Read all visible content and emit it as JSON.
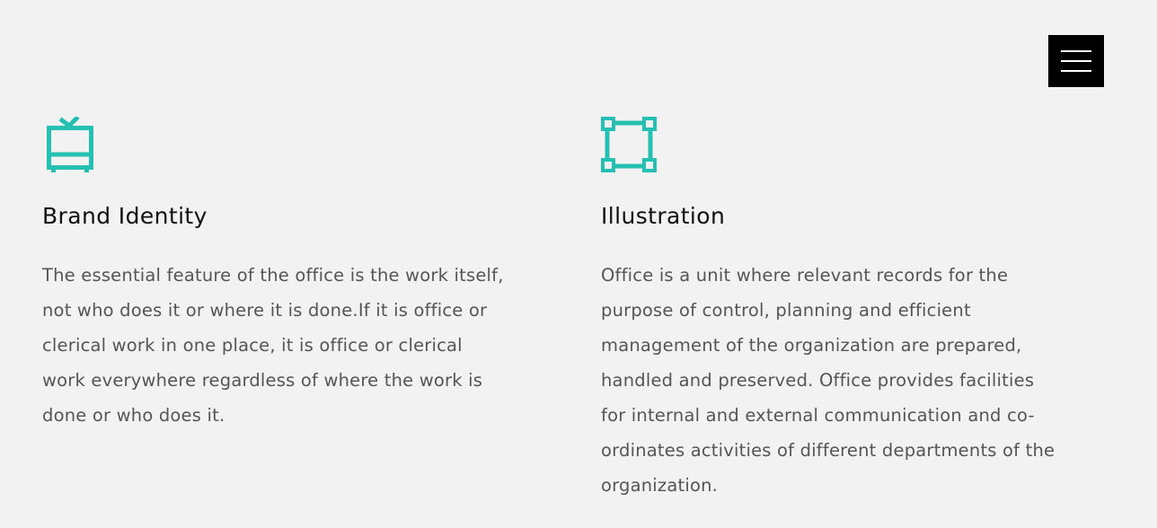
{
  "header": {
    "menu_icon": "hamburger-menu-icon"
  },
  "colors": {
    "accent": "#26c0b2",
    "background": "#f2f2f2",
    "menu_bg": "#000000",
    "text_heading": "#111111",
    "text_body": "#555555"
  },
  "services": [
    {
      "icon": "tv-icon",
      "title": "Brand Identity",
      "lines": [
        "The essential feature of the office is the work itself,",
        "not who does it or where it is done.If it is office or",
        "clerical work in one place, it is office or clerical",
        "work everywhere regardless of where the work is",
        "done or who does it."
      ]
    },
    {
      "icon": "vector-square-icon",
      "title": "Illustration",
      "lines": [
        "Office is a unit where relevant records for the",
        "purpose of control, planning and efficient",
        "management of the organization are prepared,",
        "handled and preserved. Office provides facilities",
        "for internal and external communication and co-",
        "ordinates activities of different departments of the",
        "organization."
      ]
    }
  ]
}
